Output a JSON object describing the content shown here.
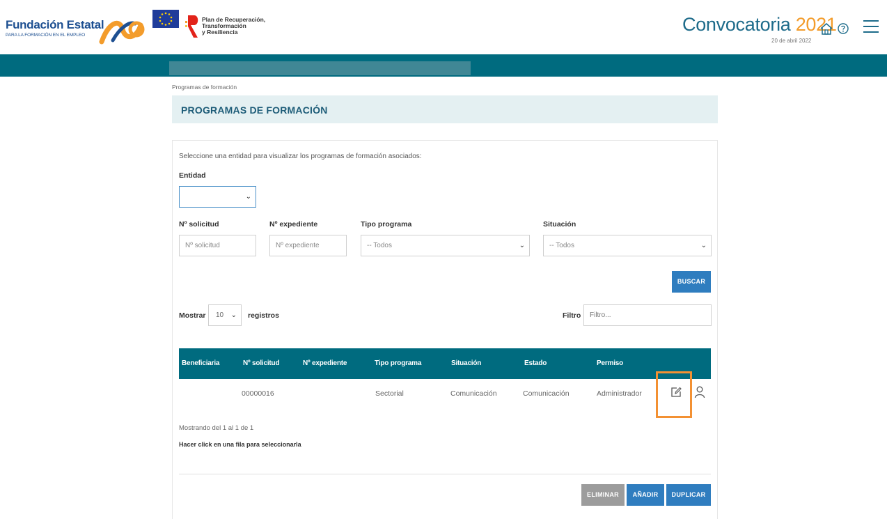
{
  "header": {
    "org_name": "Fundación Estatal",
    "org_subtitle": "PARA LA FORMACIÓN EN EL EMPLEO",
    "plan_line1": "Plan de Recuperación,",
    "plan_line2": "Transformación",
    "plan_line3": "y Resiliencia",
    "convocatoria_label": "Convocatoria",
    "convocatoria_year": "2021",
    "date": "20 de abril 2022"
  },
  "breadcrumb": "Programas de formación",
  "page_title": "PROGRAMAS DE FORMACIÓN",
  "form": {
    "intro": "Seleccione una entidad para visualizar los programas de formación asociados:",
    "entidad_label": "Entidad",
    "entidad_value": "",
    "solicitud_label": "Nº solicitud",
    "solicitud_placeholder": "Nº solicitud",
    "expediente_label": "Nº expediente",
    "expediente_placeholder": "Nº expediente",
    "tipo_label": "Tipo programa",
    "tipo_value": "-- Todos",
    "situacion_label": "Situación",
    "situacion_value": "-- Todos",
    "buscar_label": "BUSCAR"
  },
  "table_controls": {
    "mostrar_label": "Mostrar",
    "page_size": "10",
    "registros_label": "registros",
    "filtro_label": "Filtro",
    "filtro_placeholder": "Filtro..."
  },
  "table": {
    "columns": [
      "Beneficiaria",
      "Nº solicitud",
      "Nº expediente",
      "Tipo programa",
      "Situación",
      "Estado",
      "Permiso"
    ],
    "rows": [
      [
        "",
        "00000016",
        "",
        "Sectorial",
        "Comunicación",
        "Comunicación",
        "Administrador"
      ]
    ]
  },
  "footer": {
    "showing": "Mostrando del 1 al 1 de 1",
    "hint": "Hacer click en una fila para seleccionarla",
    "eliminar_label": "ELIMINAR",
    "anadir_label": "AÑADIR",
    "duplicar_label": "DUPLICAR"
  },
  "colors": {
    "primary_teal": "#006b7f",
    "button_blue": "#2f7dbf",
    "highlight_orange": "#f39133",
    "accent_orange": "#f39c2b"
  }
}
